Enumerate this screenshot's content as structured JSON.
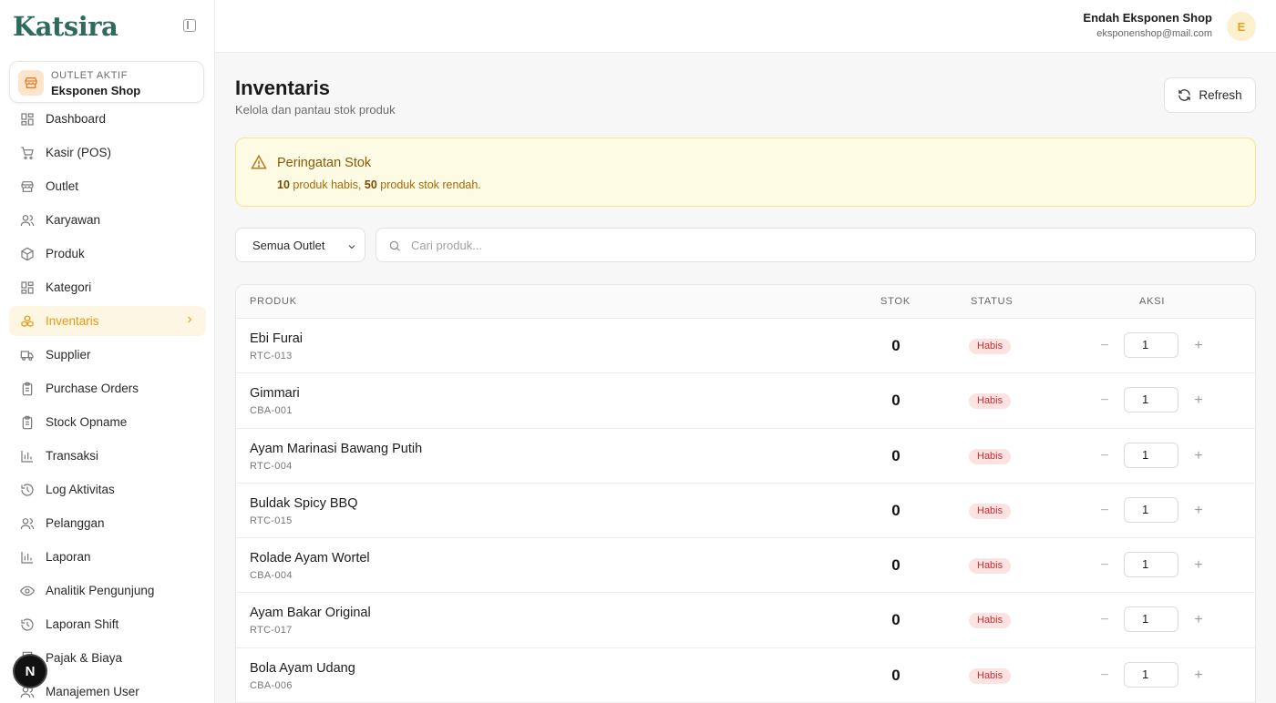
{
  "app": {
    "logo": "Katsira"
  },
  "outlet": {
    "kicker": "OUTLET AKTIF",
    "name": "Eksponen Shop"
  },
  "sidebar": {
    "items": [
      {
        "label": "Dashboard",
        "icon": "grid-icon"
      },
      {
        "label": "Kasir (POS)",
        "icon": "cart-icon"
      },
      {
        "label": "Outlet",
        "icon": "store-icon"
      },
      {
        "label": "Karyawan",
        "icon": "users-icon"
      },
      {
        "label": "Produk",
        "icon": "box-icon"
      },
      {
        "label": "Kategori",
        "icon": "grid-icon"
      },
      {
        "label": "Inventaris",
        "icon": "boxes-icon",
        "active": true
      },
      {
        "label": "Supplier",
        "icon": "truck-icon"
      },
      {
        "label": "Purchase Orders",
        "icon": "clipboard-icon"
      },
      {
        "label": "Stock Opname",
        "icon": "clipboard-icon"
      },
      {
        "label": "Transaksi",
        "icon": "bar-chart-icon"
      },
      {
        "label": "Log Aktivitas",
        "icon": "history-icon"
      },
      {
        "label": "Pelanggan",
        "icon": "users-icon"
      },
      {
        "label": "Laporan",
        "icon": "bar-chart-icon"
      },
      {
        "label": "Analitik Pengunjung",
        "icon": "eye-icon"
      },
      {
        "label": "Laporan Shift",
        "icon": "history-icon"
      },
      {
        "label": "Pajak & Biaya",
        "icon": "receipt-icon"
      },
      {
        "label": "Manajemen User",
        "icon": "users-icon"
      }
    ],
    "badge": "N"
  },
  "user": {
    "name": "Endah Eksponen Shop",
    "email": "eksponenshop@mail.com",
    "initial": "E"
  },
  "page": {
    "title": "Inventaris",
    "subtitle": "Kelola dan pantau stok produk",
    "refresh_label": "Refresh"
  },
  "alert": {
    "title": "Peringatan Stok",
    "out_count": "10",
    "out_text": " produk habis, ",
    "low_count": "50",
    "low_text": " produk stok rendah."
  },
  "filters": {
    "outlet_selected": "Semua Outlet",
    "search_placeholder": "Cari produk..."
  },
  "table": {
    "headers": {
      "product": "PRODUK",
      "stock": "STOK",
      "status": "STATUS",
      "action": "AKSI"
    },
    "rows": [
      {
        "name": "Ebi Furai",
        "sku": "RTC-013",
        "stock": "0",
        "status": "Habis",
        "qty": "1"
      },
      {
        "name": "Gimmari",
        "sku": "CBA-001",
        "stock": "0",
        "status": "Habis",
        "qty": "1"
      },
      {
        "name": "Ayam Marinasi Bawang Putih",
        "sku": "RTC-004",
        "stock": "0",
        "status": "Habis",
        "qty": "1"
      },
      {
        "name": "Buldak Spicy BBQ",
        "sku": "RTC-015",
        "stock": "0",
        "status": "Habis",
        "qty": "1"
      },
      {
        "name": "Rolade Ayam Wortel",
        "sku": "CBA-004",
        "stock": "0",
        "status": "Habis",
        "qty": "1"
      },
      {
        "name": "Ayam Bakar Original",
        "sku": "RTC-017",
        "stock": "0",
        "status": "Habis",
        "qty": "1"
      },
      {
        "name": "Bola Ayam Udang",
        "sku": "CBA-006",
        "stock": "0",
        "status": "Habis",
        "qty": "1"
      }
    ]
  },
  "colors": {
    "accent": "#e49b12",
    "brand": "#2f6b5d",
    "danger": "#c53030",
    "warning_bg": "#fefbe4"
  }
}
